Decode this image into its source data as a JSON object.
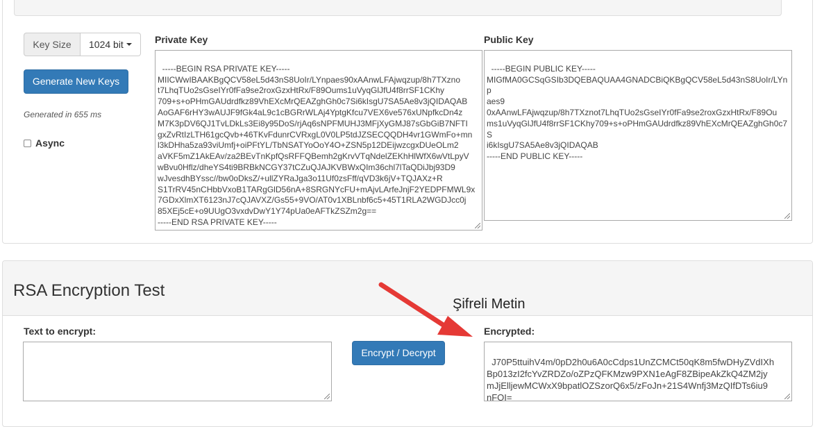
{
  "key_section": {
    "key_size_label": "Key Size",
    "key_size_value": "1024 bit",
    "generate_button": "Generate New Keys",
    "generated_text": "Generated in 655 ms",
    "async_label": "Async",
    "private_key_label": "Private Key",
    "private_key_value": "-----BEGIN RSA PRIVATE KEY-----\nMIICWwIBAAKBgQCV58eL5d43nS8UoIr/LYnpaes90xAAnwLFAjwqzup/8h7TXzno\nt7LhqTUo2sGseIYr0fFa9se2roxGzxHtRx/F89Oums1uVyqGlJfU4f8rrSF1CKhy\n709+s+oPHmGAUdrdfkz89VhEXcMrQEAZghGh0c7Si6kIsgU7SA5Ae8v3jQIDAQAB\nAoGAF6rHY3wAUJF9fGk4aL9c1cBGRrWLAj4YptgKfcu7VEX6ve576xUNpfkcDn4z\nM7K3pDV6QJ1TvLDkLs3Ei8y95DoS/rjAq6sNPFMUHJ3MFjXyGMJ87sGbGiB7NFTI\ngxZvRtIzLTH61gcQvb+46TKvFdunrCVRxgL0V0LP5tdJZSECQQDH4vr1GWmFo+mn\nl3kDHha5za93viUmfj+oiPFtYL/TbNSATYoOoY4O+ZSN5p12DEijwzcgxDUeOLm2\naVKF5mZ1AkEAv/za2BEvTnKpfQsRFFQBemh2gKrvVTqNdelZEKhHlWfX6wVtLpyV\nwBvu0Hflz/dheYS4ti9BRBkNCGY37tCZuQJAJKVBWxQIm36chl7lTaQDiJbj93D9\nwJvesdhBYssc//bw0oDksZ/+ullZYRaJga3o11Uf0zsFff/qVD3k6jV+TQJAXz+R\nS1TrRV45nCHbbVxoB1TARgGlD56nA+8SRGNYcFU+mAjvLArfeJnjF2YEDPFMWL9x\n7GDxXlmXT6123nJ7cQJAVXZ/Gs55+9VO/AT0v1XBLnbf6c5+45T1RLA2WGDJcc0j\n85XEj5cE+o9UUgO3vxdvDwY1Y74pUa0eAFTkZSZm2g==\n-----END RSA PRIVATE KEY-----",
    "public_key_label": "Public Key",
    "public_key_value": "-----BEGIN PUBLIC KEY-----\nMIGfMA0GCSqGSIb3DQEBAQUAA4GNADCBiQKBgQCV58eL5d43nS8UoIr/LYnp\naes9\n0xAAnwLFAjwqzup/8h7TXznot7LhqTUo2sGseIYr0fFa9se2roxGzxHtRx/F89Ou\nms1uVyqGlJfU4f8rrSF1CKhy709+s+oPHmGAUdrdfkz89VhEXcMrQEAZghGh0c7S\ni6kIsgU7SA5Ae8v3jQIDAQAB\n-----END PUBLIC KEY-----"
  },
  "encryption_section": {
    "title": "RSA Encryption Test",
    "text_label": "Text to encrypt:",
    "text_value": "",
    "button": "Encrypt / Decrypt",
    "annotation": "Şifreli Metin",
    "encrypted_label": "Encrypted:",
    "encrypted_value": "J70P5ttuihV4m/0pD2h0u6A0cCdps1UnZCMCt50qK8m5fwDHyZVdIXh\nBp013zI2fcYvZRDZo/oZPzQFKMzw9PXN1eAgF8ZBipeAkZkQ4ZM2jy\nmJjElljewMCWxX9bpatlOZSzorQ6x5/zFoJn+21S4Wnfj3MzQIfDTs6iu9\nnFOI="
  },
  "colors": {
    "primary": "#337ab7",
    "arrow": "#e53935"
  }
}
